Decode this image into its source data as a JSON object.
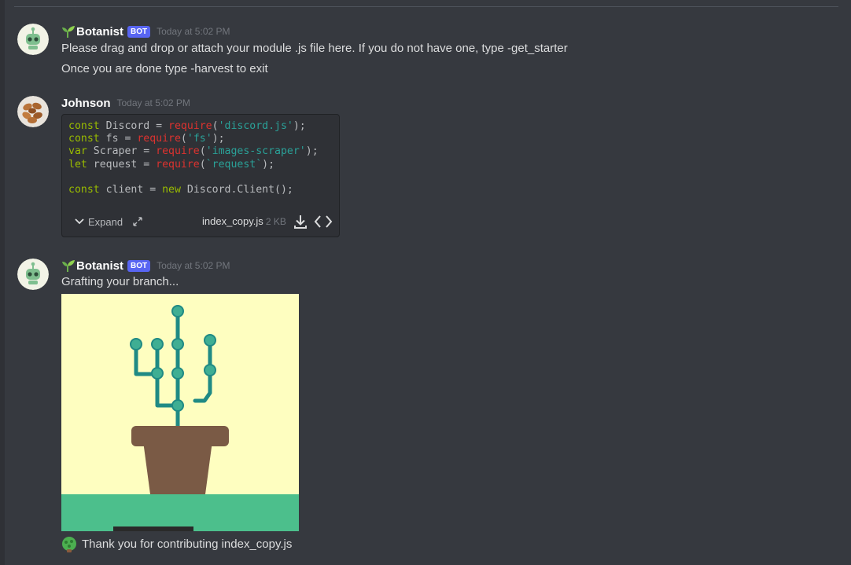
{
  "messages": [
    {
      "author": "Botanist",
      "bot_tag": "BOT",
      "timestamp": "Today at 5:02 PM",
      "lines": [
        "Please drag and drop or attach your module .js file here. If you do not have one, type -get_starter",
        "Once you are done type -harvest to exit"
      ]
    },
    {
      "author": "Johnson",
      "timestamp": "Today at 5:02 PM",
      "code": {
        "lines": [
          "const Discord = require('discord.js');",
          "const fs = require('fs');",
          "var Scraper = require('images-scraper');",
          "let request = require(`request`);",
          "",
          "const client = new Discord.Client();"
        ],
        "expand_label": "Expand",
        "file_name": "index_copy.js",
        "file_size": "2 KB"
      }
    },
    {
      "author": "Botanist",
      "bot_tag": "BOT",
      "timestamp": "Today at 5:02 PM",
      "text": "Grafting your branch...",
      "footer_text": "Thank you for contributing index_copy.js"
    }
  ],
  "colors": {
    "background": "#36393f",
    "bot_tag": "#5865f2",
    "image_background": "#fefec0",
    "ground": "#4cbf8c",
    "pot": "#7a5a45",
    "branch": "#1f8a84"
  }
}
